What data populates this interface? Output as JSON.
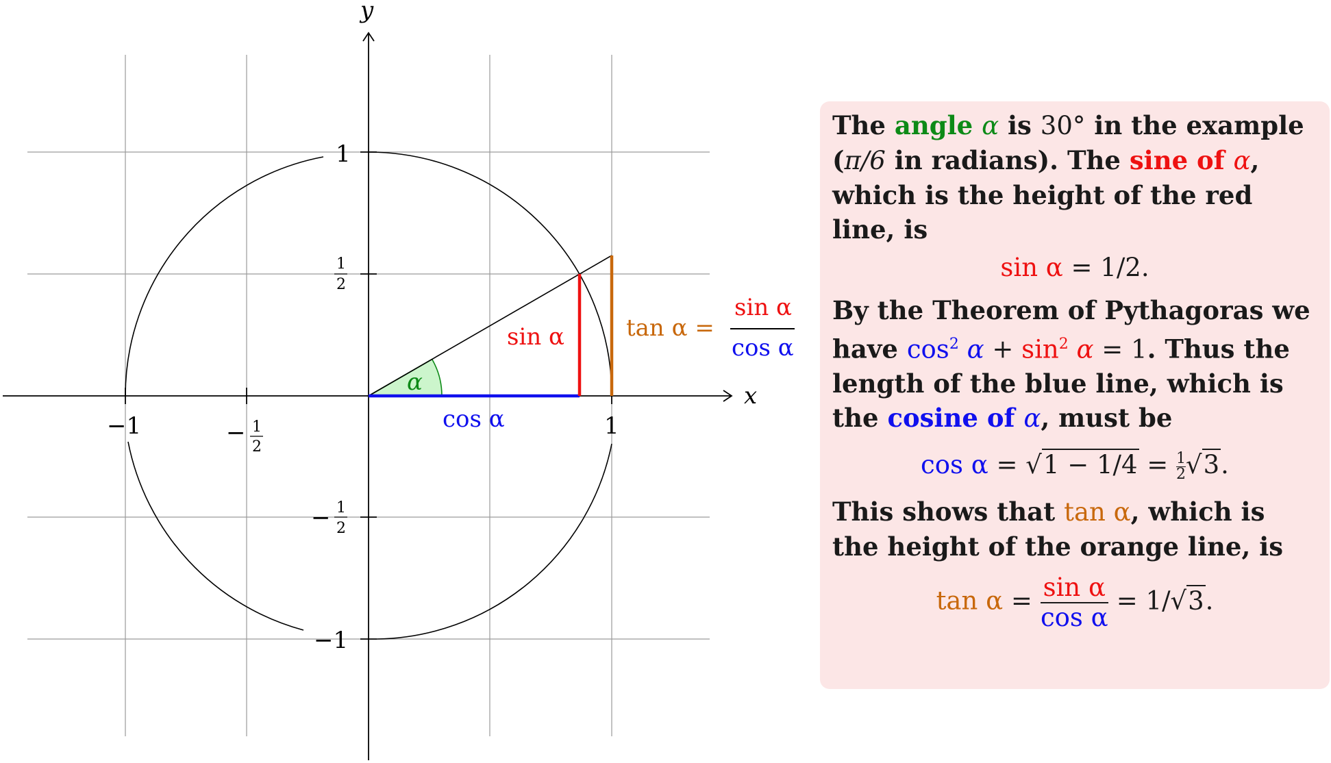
{
  "diagram": {
    "axis_x_label": "x",
    "axis_y_label": "y",
    "x_ticks": [
      "−1",
      "−",
      "1",
      "2",
      "1"
    ],
    "y_ticks": [
      "1",
      "1",
      "2",
      "−",
      "1",
      "2",
      "−1"
    ],
    "angle_label": "α",
    "sin_label": "sin α",
    "cos_label": "cos α",
    "tan_label": "tan α =",
    "tan_frac_num": "sin α",
    "tan_frac_den": "cos α",
    "angle_degrees": 30,
    "colors": {
      "green": "#0d8a17",
      "red": "#ee1111",
      "blue": "#1010ee",
      "orange": "#c8680c",
      "angle_fill": "#ccf5cc",
      "grid": "#999999"
    }
  },
  "textbox": {
    "p1_a": "The",
    "p1_angle": "angle",
    "p1_alpha": "α",
    "p1_b": "is",
    "p1_deg": "30°",
    "p1_c": "in the example",
    "p1_d": "(",
    "p1_pi": "π/6",
    "p1_e": "in radians).  The",
    "p1_sine": "sine of",
    "p1_alpha2": "α",
    "p1_f": ", which is the height of the red line, is",
    "eq1_lhs": "sin α",
    "eq1_rhs": " = 1/2.",
    "p2_a": "By the Theorem of Pythagoras we have",
    "p2_cos": "cos",
    "p2_sup1": "2",
    "p2_alpha1": " α",
    "p2_plus": " + ",
    "p2_sin": "sin",
    "p2_sup2": "2",
    "p2_alpha2": " α",
    "p2_eq1": " = 1",
    "p2_b": ".  Thus the length of the blue line, which is the",
    "p2_cosine": "cosine of",
    "p2_alpha3": "α",
    "p2_c": ", must be",
    "eq2_lhs": "cos α",
    "eq2_mid": " = √",
    "eq2_rad": "1 − 1/4",
    "eq2_eq": " = ",
    "eq2_num": "1",
    "eq2_den": "2",
    "eq2_tail": "√",
    "eq2_tail_rad": "3",
    "eq2_dot": ".",
    "p3_a": "This shows that",
    "p3_tan": "tan α",
    "p3_b": ", which is the height of the orange line, is",
    "eq3_lhs": "tan α",
    "eq3_eq": " = ",
    "eq3_num": "sin α",
    "eq3_den": "cos α",
    "eq3_rhs": " = 1/",
    "eq3_sqrt": "√",
    "eq3_rad": "3",
    "eq3_dot": "."
  }
}
